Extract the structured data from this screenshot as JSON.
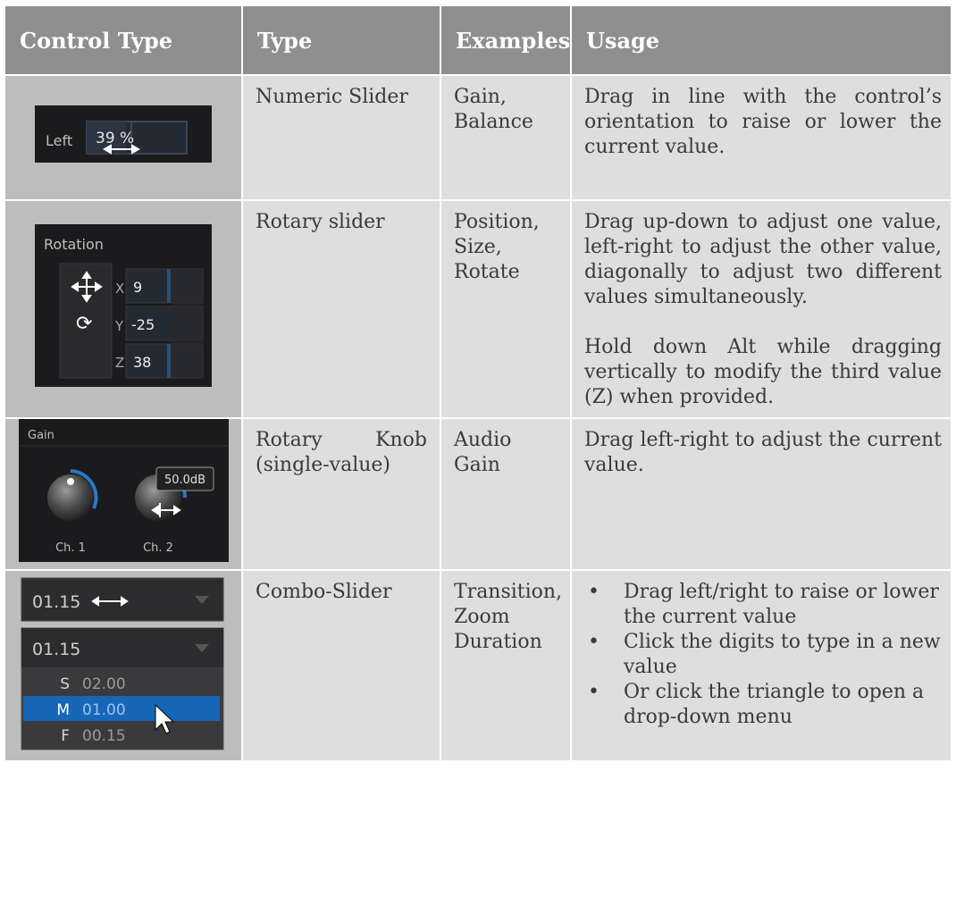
{
  "headers": [
    "Control Type",
    "Type",
    "Examples",
    "Usage"
  ],
  "rows": [
    {
      "type": "Numeric Slider",
      "examples": "Gain,\nBalance",
      "usage": [
        "Drag in line with the control’s orientation to raise or lower the current value."
      ]
    },
    {
      "type": "Rotary slider",
      "examples": "Position,\nSize,\nRotate",
      "usage": [
        "Drag up-down to adjust one value, left-right to adjust the other value, diagonally to adjust two different values simultaneously.",
        "Hold down Alt while dragging vertically to modify the third value (Z) when provided."
      ]
    },
    {
      "type": "Rotary Knob (single-value)",
      "examples": "Audio\nGain",
      "usage": [
        "Drag left-right to adjust the current value."
      ]
    },
    {
      "type": "Combo-Slider",
      "examples": "Transition,\nZoom\nDuration",
      "usage_bullets": [
        "Drag left/right to raise or lower the current value",
        "Click the digits to type in a new value",
        "Or click the triangle to open a drop-down menu"
      ]
    }
  ],
  "ui": {
    "numeric": {
      "label": "Left",
      "value": "39 %"
    },
    "rotary": {
      "title": "Rotation",
      "axes": [
        "X",
        "Y",
        "Z"
      ],
      "values": [
        "9",
        "-25",
        "38"
      ]
    },
    "knob": {
      "title": "Gain",
      "tooltip": "50.0dB",
      "ch1": "Ch. 1",
      "ch2": "Ch. 2"
    },
    "combo": {
      "value_top": "01.15",
      "value_bottom": "01.15",
      "options": [
        {
          "key": "S",
          "value": "02.00"
        },
        {
          "key": "M",
          "value": "01.00"
        },
        {
          "key": "F",
          "value": "00.15"
        }
      ]
    }
  }
}
